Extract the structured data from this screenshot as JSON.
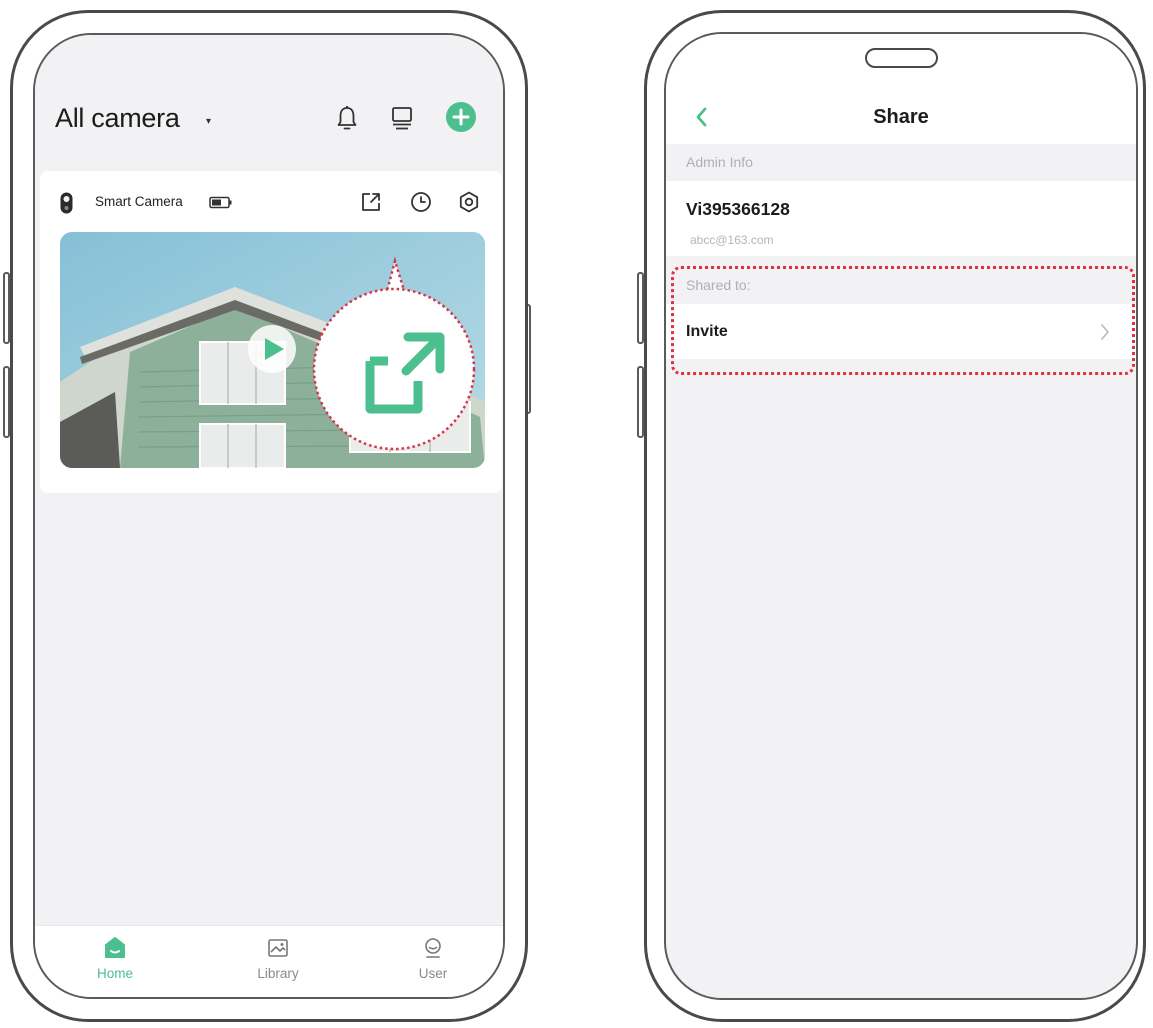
{
  "left_screen": {
    "header": {
      "title": "All camera",
      "caret": "▾"
    },
    "camera_card": {
      "name": "Smart Camera"
    },
    "tabbar": {
      "home": "Home",
      "library": "Library",
      "user": "User"
    }
  },
  "right_screen": {
    "nav": {
      "title": "Share"
    },
    "admin_section": "Admin Info",
    "admin": {
      "uid": "Vi395366128",
      "email": "abcc@163.com"
    },
    "shared_section": "Shared to:",
    "invite_row": "Invite"
  },
  "colors": {
    "accent_green": "#4cbf8f",
    "highlight_red": "#e03140",
    "background_gray": "#f2f2f4"
  },
  "icons": [
    "bell-icon",
    "monitor-icon",
    "add-icon",
    "camera-icon",
    "battery-icon",
    "share-icon",
    "clock-icon",
    "gear-icon",
    "play-icon",
    "home-icon",
    "library-icon",
    "user-icon",
    "back-arrow-icon",
    "chevron-right-icon"
  ]
}
